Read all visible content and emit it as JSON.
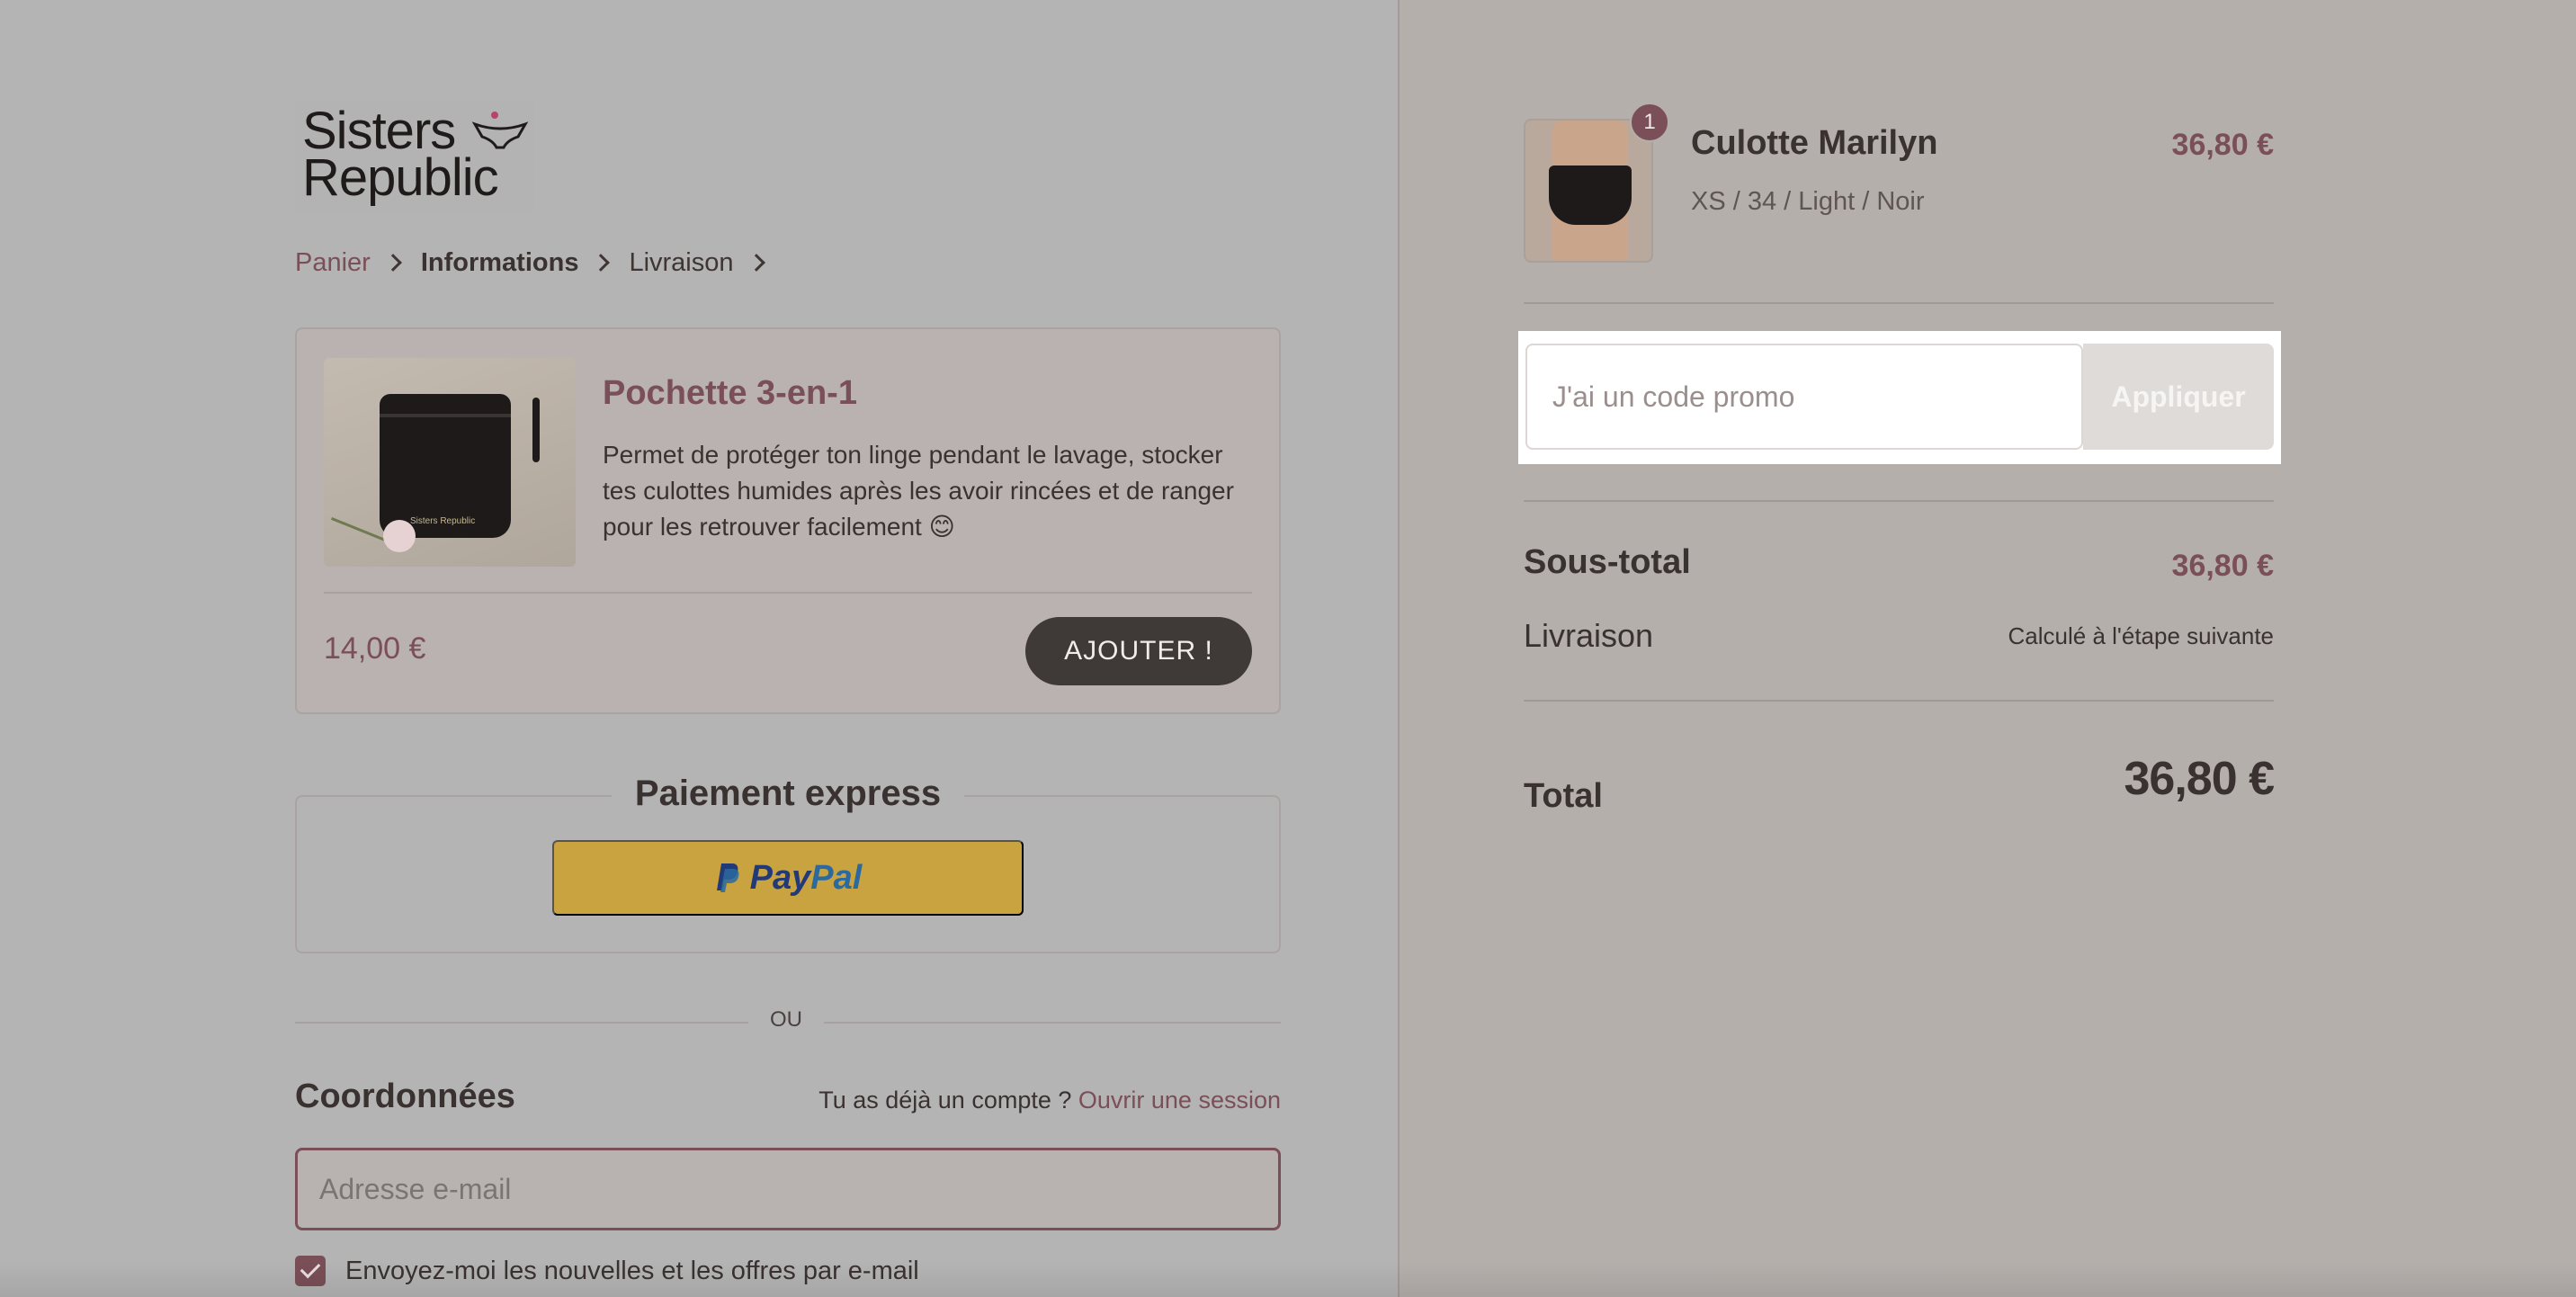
{
  "logo": {
    "line1": "Sisters",
    "line2": "Republic"
  },
  "breadcrumb": {
    "cart": "Panier",
    "info": "Informations",
    "shipping": "Livraison"
  },
  "upsell": {
    "title": "Pochette 3-en-1",
    "description": "Permet de protéger ton linge pendant le lavage, stocker tes culottes humides après les avoir rincées et de ranger pour les retrouver facilement 😊",
    "image_text": "Sisters Republic",
    "price": "14,00 €",
    "add_label": "AJOUTER !"
  },
  "express": {
    "title": "Paiement express",
    "paypal_pay": "Pay",
    "paypal_pal": "Pal"
  },
  "divider": {
    "or": "OU"
  },
  "contact": {
    "title": "Coordonnées",
    "account_prompt": "Tu as déjà un compte ? ",
    "login_link": "Ouvrir une session",
    "email_placeholder": "Adresse e-mail",
    "email_value": "",
    "newsletter_label": "Envoyez-moi les nouvelles et les offres par e-mail",
    "newsletter_checked": true
  },
  "cart": {
    "item_name": "Culotte Marilyn",
    "item_variant": "XS / 34 / Light / Noir",
    "item_price": "36,80 €",
    "item_qty": "1"
  },
  "promo": {
    "placeholder": "J'ai un code promo",
    "apply_label": "Appliquer"
  },
  "summary": {
    "subtotal_label": "Sous-total",
    "subtotal_value": "36,80 €",
    "shipping_label": "Livraison",
    "shipping_value": "Calculé à l'étape suivante",
    "total_label": "Total",
    "total_value": "36,80 €"
  },
  "colors": {
    "accent": "#7a4f57",
    "paypal": "#c9a340",
    "dark_button": "#3f3937"
  }
}
